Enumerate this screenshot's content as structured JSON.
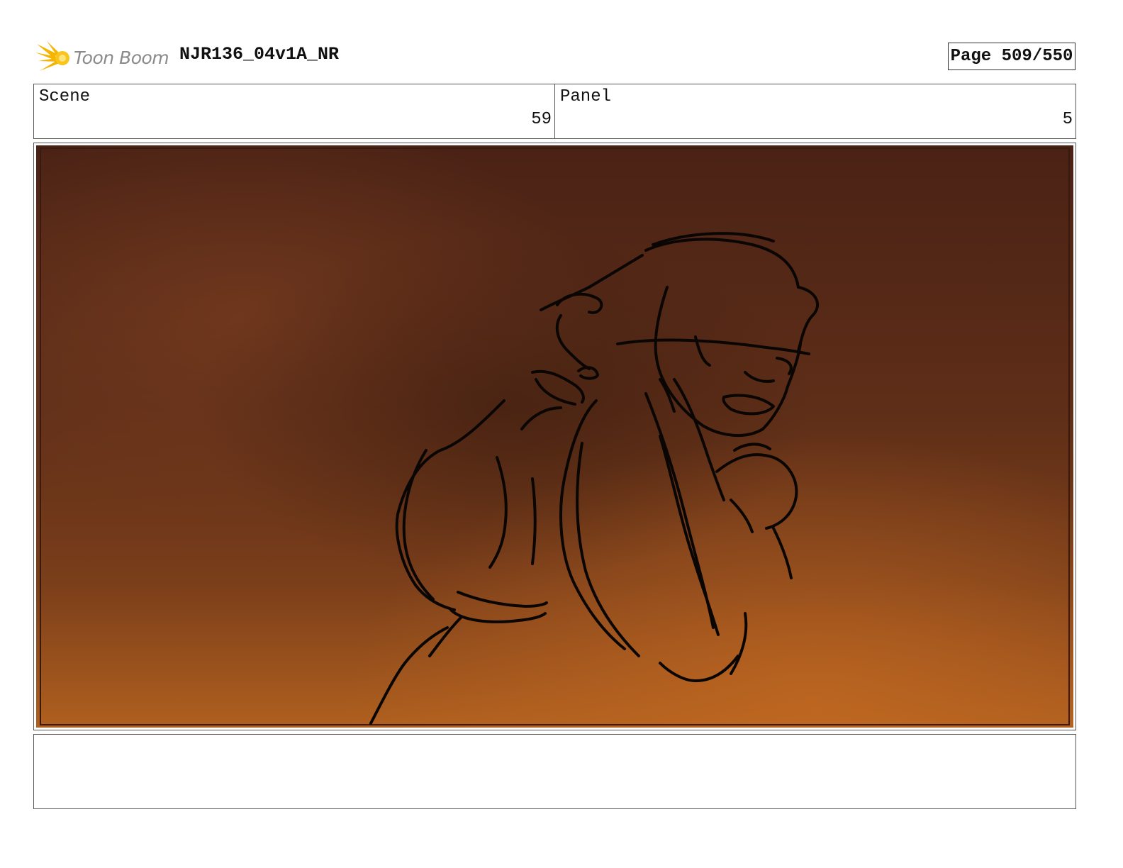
{
  "header": {
    "logo_text": "Toon Boom",
    "document_title": "NJR136_04v1A_NR",
    "page_label": "Page 509/550"
  },
  "panel_info": {
    "scene_label": "Scene",
    "scene_value": "59",
    "panel_label": "Panel",
    "panel_value": "5"
  },
  "artwork": {
    "subject": "rough sketch of a character looking back over shoulder, mouth open",
    "background_colors": [
      "#3e1d12",
      "#6b351c",
      "#a85a1e"
    ],
    "line_color": "#0a0604"
  },
  "notes": {
    "text": ""
  }
}
